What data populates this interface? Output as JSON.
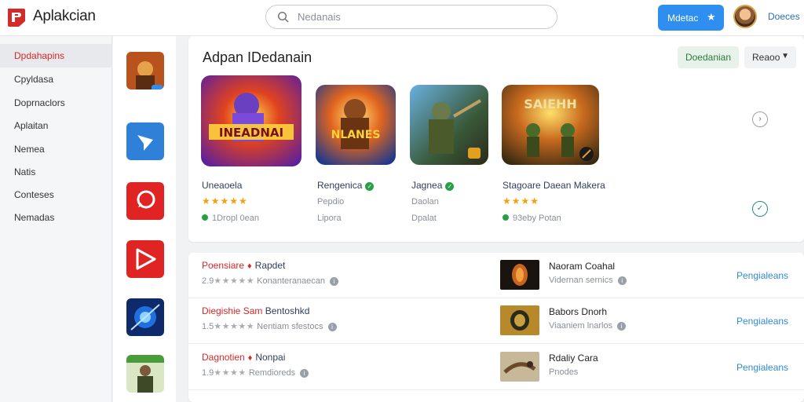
{
  "header": {
    "app_name": "Aplakcian",
    "search_placeholder": "Nedanais",
    "action_button": "Mdetac",
    "user_name": "Doeces"
  },
  "sidebar": {
    "items": [
      {
        "label": "Dpdahapins",
        "active": true
      },
      {
        "label": "Cpyldasa",
        "active": false
      },
      {
        "label": "Doprnaclors",
        "active": false
      },
      {
        "label": "Aplaitan",
        "active": false
      },
      {
        "label": "Nemea",
        "active": false
      },
      {
        "label": "Natis",
        "active": false
      },
      {
        "label": "Conteses",
        "active": false
      },
      {
        "label": "Nemadas",
        "active": false
      }
    ]
  },
  "featured": {
    "title": "Adpan IDedanain",
    "primary_button": "Doedanian",
    "filter_label": "Reaoo",
    "games": [
      {
        "name": "Uneaoela",
        "verified": false,
        "stars": "★★★★★",
        "sub": "1Dropl 0ean",
        "sub_dot": true,
        "art_text": "INEADNAI"
      },
      {
        "name": "Rengenica",
        "verified": true,
        "stars": "",
        "sub": "Pepdio",
        "sub2": "Lipora",
        "sub_dot": false,
        "art_text": "NLANES"
      },
      {
        "name": "Jagnea",
        "verified": true,
        "stars": "",
        "sub": "Daolan",
        "sub2": "Dpalat",
        "sub_dot": false,
        "art_text": ""
      },
      {
        "name": "Stagoare Daean Makera",
        "verified": false,
        "stars": "★★★★",
        "sub": "93eby Potan",
        "sub_dot": true,
        "art_text": "SAIEHH"
      }
    ]
  },
  "list": {
    "rows": [
      {
        "title_red": "Poensiare",
        "title_blue": "Rapdet",
        "rating": "2.9",
        "stars": "★★★★★",
        "meta": "Konanteranaecan",
        "thumb_name": "Naoram Coahal",
        "thumb_sub": "Vidernan sernics",
        "action": "Pengialeans"
      },
      {
        "title_red": "Diegishie Sam",
        "title_blue": "Bentoshkd",
        "rating": "1.5",
        "stars": "★★★★★",
        "meta": "Nentiam sfestocs",
        "thumb_name": "Babors Dnorh",
        "thumb_sub": "Viaaniem lnarlos",
        "action": "Pengialeans"
      },
      {
        "title_red": "Dagnotien",
        "title_blue": "Nonpai",
        "rating": "1.9",
        "stars": "★★★★",
        "meta": "Remdioreds",
        "thumb_name": "Rdaliy Cara",
        "thumb_sub": "Pnodes",
        "action": "Pengialeans"
      }
    ]
  },
  "colors": {
    "accent": "#2f8ff0",
    "brand_red": "#d42a2a",
    "verified_green": "#27a045",
    "star_gold": "#f2a20c"
  }
}
